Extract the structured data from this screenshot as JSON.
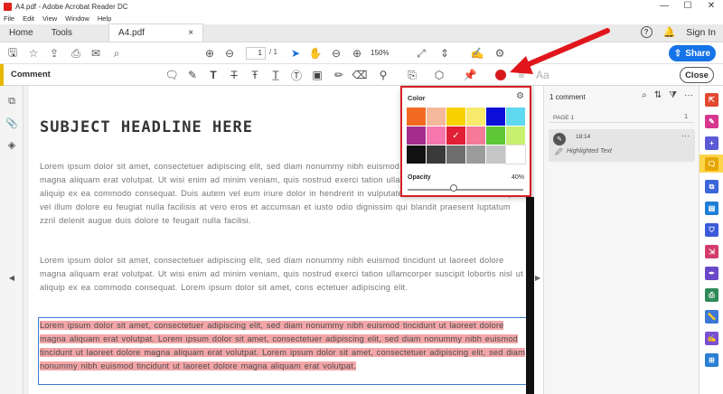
{
  "window": {
    "title": "A4.pdf - Adobe Acrobat Reader DC",
    "minimize": "—",
    "maximize": "☐",
    "close": "✕"
  },
  "menu": [
    "File",
    "Edit",
    "View",
    "Window",
    "Help"
  ],
  "tabs": {
    "home": "Home",
    "tools": "Tools",
    "doc": "A4.pdf",
    "doc_close": "×",
    "help": "?",
    "signin": "Sign In"
  },
  "toolbar": {
    "page_current": "1",
    "page_total": "/ 1",
    "zoom": "150%",
    "share_label": "Share"
  },
  "comment_bar": {
    "label": "Comment",
    "close_label": "Close",
    "font_label": "Aa"
  },
  "document": {
    "headline": "SUBJECT HEADLINE HERE",
    "para1": "Lorem ipsum dolor sit amet, consectetuer adipiscing elit, sed diam nonummy nibh euismod tincidunt ut laoreet dolore magna aliquam erat volutpat. Ut wisi enim ad minim veniam, quis nostrud exerci tation ullamcorper suscipit lobortis nisl ut aliquip ex ea commodo consequat. Duis autem vel eum iriure dolor in hendrerit in vulputate velit esse molestie consequat, vel illum dolore eu feugiat nulla facilisis at vero eros et accumsan et iusto odio dignissim qui blandit praesent luptatum zzril delenit augue duis dolore te feugait nulla facilisi.",
    "para2": "Lorem ipsum dolor sit amet, consectetuer adipiscing elit, sed diam nonummy nibh euismod tincidunt ut laoreet dolore magna aliquam erat volutpat. Ut wisi enim ad minim veniam, quis nostrud exerci tation ullamcorper suscipit lobortis nisl ut aliquip ex ea commodo consequat. Lorem ipsum dolor sit amet, cons ectetuer adipiscing elit.",
    "para3": "Lorem ipsum dolor sit amet, consectetuer adipiscing elit, sed diam nonummy nibh euismod tincidunt ut laoreet dolore magna aliquam erat volutpat. Lorem ipsum dolor sit amet, consectetuer adipiscing elit, sed diam nonummy nibh euismod tincidunt ut laoreet dolore magna aliquam erat volutpat. Lorem ipsum dolor sit amet, consectetuer adipiscing elit, sed diam nonummy nibh euismod tincidunt ut laoreet dolore magna aliquam erat volutpat."
  },
  "color_popover": {
    "title": "Color",
    "opacity_label": "Opacity",
    "opacity_value": "40%",
    "opacity_fraction": 0.4,
    "swatches": [
      "#f26a22",
      "#f4b89a",
      "#f8d100",
      "#f7ea6c",
      "#0b0fd8",
      "#5ed9ef",
      "#a42c8d",
      "#f577ae",
      "#e11f36",
      "#f47a97",
      "#5dc735",
      "#c8f06f",
      "#111111",
      "#3a3a3a",
      "#6e6e6e",
      "#9b9b9b",
      "#c6c6c6",
      "#ffffff"
    ],
    "selected_index": 8,
    "check": "✓"
  },
  "comments_panel": {
    "header": "1 comment",
    "page_label": "PAGE 1",
    "page_count": "1",
    "comment": {
      "time": "18:14",
      "text": "Highlighted Text",
      "more": "···"
    }
  },
  "colors": {
    "accent": "#1473e6",
    "highlight": "#f3a6a8",
    "annotation_red": "#d71f26",
    "comment_yellow": "#e6b800"
  }
}
